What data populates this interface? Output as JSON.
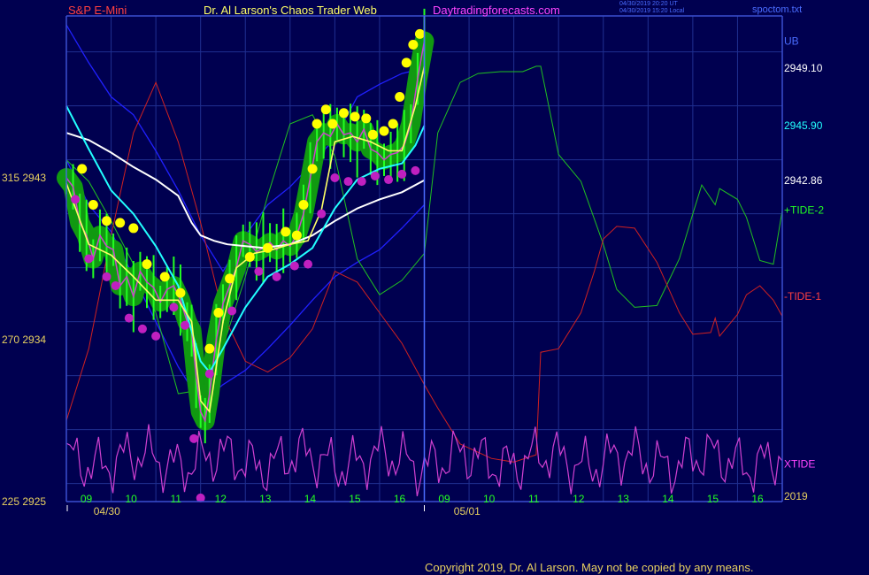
{
  "header": {
    "symbol": "S&P E-Mini",
    "title": "Dr. Al Larson's Chaos Trader Web",
    "site": "Daytradingforecasts.com",
    "timestamp_ut": "04/30/2019 20:20 UT",
    "timestamp_local": "04/30/2019 15:20 Local",
    "file": "spoctom.txt"
  },
  "footer": {
    "copyright": "Copyright 2019, Dr. Al Larson. May not be copied by any means."
  },
  "colors": {
    "background": "#000050",
    "grid": "#1f2f90",
    "axis": "#3a4fd0",
    "price_candles": "#22ff22",
    "price_halo": "#119911",
    "highs": "#ffff00",
    "lows": "#c020c0",
    "fast_ma": "#ffff66",
    "mid_ma": "#22ffff",
    "slow_ma": "#ffffff",
    "band": "#2020ff",
    "tide_plus": "#20c020",
    "tide_minus": "#d02020",
    "xtide": "#d040d0"
  },
  "chart_data": {
    "type": "line",
    "title": "S&P E-Mini",
    "y_range": [
      2925,
      2952
    ],
    "left_axis_labels": [
      {
        "text": "315  2943",
        "value": 2943
      },
      {
        "text": "270  2934",
        "value": 2934
      },
      {
        "text": "225  2925",
        "value": 2925
      }
    ],
    "right_axis_labels": [
      {
        "text": "UB",
        "value": 2950.6,
        "color": "#4a6cff"
      },
      {
        "text": "2949.10",
        "value": 2949.1,
        "color": "#ffffff"
      },
      {
        "text": "2945.90",
        "value": 2945.9,
        "color": "#22ffff"
      },
      {
        "text": "2942.86",
        "value": 2942.86,
        "color": "#ffffff"
      },
      {
        "text": "+TIDE-2",
        "value": 2941.2,
        "color": "#22ff22"
      },
      {
        "text": "-TIDE-1",
        "value": 2936.4,
        "color": "#ff4040"
      },
      {
        "text": "XTIDE",
        "value": 2927.1,
        "color": "#ff44ff"
      },
      {
        "text": "2019",
        "value": 2925.3,
        "color": "#e8d060"
      }
    ],
    "x_range": [
      0,
      16
    ],
    "hour_ticks": [
      {
        "label": "09",
        "x": 1
      },
      {
        "label": "10",
        "x": 2
      },
      {
        "label": "11",
        "x": 3
      },
      {
        "label": "12",
        "x": 4
      },
      {
        "label": "13",
        "x": 5
      },
      {
        "label": "14",
        "x": 6
      },
      {
        "label": "15",
        "x": 7
      },
      {
        "label": "16",
        "x": 8
      },
      {
        "label": "09",
        "x": 9
      },
      {
        "label": "10",
        "x": 10
      },
      {
        "label": "11",
        "x": 11
      },
      {
        "label": "12",
        "x": 12
      },
      {
        "label": "13",
        "x": 13
      },
      {
        "label": "14",
        "x": 14
      },
      {
        "label": "15",
        "x": 15
      },
      {
        "label": "16",
        "x": 16
      }
    ],
    "date_markers": [
      {
        "label": "04/30",
        "x": 0.45
      },
      {
        "label": "05/01",
        "x": 8.5
      }
    ],
    "day_divider_x": 8,
    "series": [
      {
        "key": "price",
        "x": [
          0,
          0.15,
          0.3,
          0.45,
          0.6,
          0.75,
          0.9,
          1.05,
          1.2,
          1.35,
          1.5,
          1.65,
          1.8,
          1.95,
          2.1,
          2.25,
          2.4,
          2.55,
          2.7,
          2.8,
          2.9,
          3,
          3.1,
          3.2,
          3.35,
          3.5,
          3.65,
          3.8,
          3.95,
          4.1,
          4.25,
          4.4,
          4.55,
          4.7,
          4.85,
          5,
          5.15,
          5.3,
          5.45,
          5.6,
          5.75,
          5.9,
          6.05,
          6.2,
          6.35,
          6.5,
          6.65,
          6.8,
          6.95,
          7.1,
          7.25,
          7.4,
          7.55,
          7.7,
          7.85,
          8
        ],
        "y": [
          2943,
          2942.5,
          2940.5,
          2939.8,
          2938.5,
          2939.8,
          2939.2,
          2939,
          2937,
          2937.5,
          2936.4,
          2937.8,
          2937.2,
          2936.9,
          2936.1,
          2936.8,
          2937,
          2936.2,
          2935,
          2934.5,
          2932,
          2930,
          2929.5,
          2931,
          2934,
          2936,
          2937,
          2938,
          2939.5,
          2939.3,
          2938.9,
          2939.1,
          2939.4,
          2939,
          2939.5,
          2939.2,
          2939.8,
          2941,
          2943,
          2945,
          2945.5,
          2945.3,
          2946,
          2945.4,
          2945.5,
          2945,
          2945.7,
          2944.6,
          2944.4,
          2944,
          2944.3,
          2944.4,
          2944.8,
          2946,
          2948.5,
          2950.6
        ]
      },
      {
        "key": "highs",
        "x": [
          0.35,
          0.6,
          0.9,
          1.2,
          1.5,
          1.8,
          2.2,
          2.55,
          3.2,
          3.4,
          3.65,
          4.1,
          4.5,
          4.9,
          5.15,
          5.3,
          5.5,
          5.6,
          5.8,
          5.95,
          6.2,
          6.45,
          6.7,
          6.85,
          7.1,
          7.3,
          7.45,
          7.6,
          7.75,
          7.9
        ],
        "y": [
          2943.5,
          2941.5,
          2940.6,
          2940.5,
          2940.2,
          2938.2,
          2937.5,
          2936.6,
          2933.5,
          2935.5,
          2937.4,
          2938.6,
          2939.1,
          2940,
          2939.8,
          2941.5,
          2943.5,
          2946,
          2946.8,
          2946,
          2946.6,
          2946.4,
          2946.3,
          2945.4,
          2945.6,
          2946,
          2947.5,
          2949.4,
          2950.4,
          2951
        ]
      },
      {
        "key": "lows",
        "x": [
          0.2,
          0.5,
          0.9,
          1.1,
          1.4,
          1.7,
          2,
          2.4,
          2.65,
          2.85,
          3,
          3.2,
          3.7,
          4.3,
          4.7,
          5.1,
          5.4,
          5.7,
          6,
          6.3,
          6.6,
          6.9,
          7.2,
          7.5,
          7.8
        ],
        "y": [
          2941.8,
          2938.5,
          2937.5,
          2937,
          2935.2,
          2934.6,
          2934.2,
          2935.8,
          2934.8,
          2928.5,
          2925.2,
          2932.1,
          2935.6,
          2937.8,
          2937.5,
          2938.1,
          2938.2,
          2941,
          2943,
          2942.8,
          2942.8,
          2943.1,
          2942.9,
          2943.2,
          2943.4
        ]
      },
      {
        "key": "fast_ma",
        "x": [
          0,
          0.5,
          1,
          1.5,
          2,
          2.5,
          2.8,
          3,
          3.2,
          3.5,
          3.8,
          4.2,
          4.6,
          5,
          5.4,
          5.7,
          6,
          6.4,
          6.8,
          7.2,
          7.5,
          7.8,
          8
        ],
        "y": [
          2942.7,
          2939.3,
          2938.7,
          2937.5,
          2936.2,
          2936.2,
          2935,
          2930.6,
          2930,
          2935,
          2938,
          2938.8,
          2939,
          2939.3,
          2939.5,
          2941.2,
          2945,
          2945.3,
          2945,
          2944.5,
          2944.5,
          2947,
          2949.2
        ]
      },
      {
        "key": "mid_ma",
        "x": [
          0,
          0.5,
          1,
          1.5,
          2,
          2.5,
          3,
          3.2,
          3.5,
          4,
          4.5,
          5,
          5.5,
          6,
          6.5,
          7,
          7.5,
          7.8,
          8
        ],
        "y": [
          2947,
          2944.6,
          2942.3,
          2941,
          2939.2,
          2937,
          2932.8,
          2932.2,
          2933.5,
          2935.8,
          2937.5,
          2938.2,
          2939.1,
          2941.3,
          2942.9,
          2943.5,
          2943.8,
          2944.8,
          2945.9
        ]
      },
      {
        "key": "slow_ma",
        "x": [
          0,
          0.5,
          1,
          1.5,
          2,
          2.5,
          2.8,
          3,
          3.3,
          3.6,
          4,
          4.4,
          5,
          5.5,
          6,
          6.5,
          7,
          7.5,
          8
        ],
        "y": [
          2945.5,
          2945.1,
          2944.4,
          2943.6,
          2942.9,
          2942,
          2940.5,
          2939.8,
          2939.5,
          2939.3,
          2939.2,
          2939.1,
          2939.3,
          2939.8,
          2940.6,
          2941.3,
          2941.8,
          2942.2,
          2942.86
        ]
      },
      {
        "key": "upper_band",
        "x": [
          0,
          0.5,
          1,
          1.5,
          2,
          2.5,
          3,
          3.5,
          4,
          4.5,
          5,
          5.5,
          6,
          6.5,
          7,
          7.5,
          8
        ],
        "y": [
          2951.5,
          2949.4,
          2947.5,
          2946.5,
          2944.5,
          2942.3,
          2939.8,
          2937.8,
          2939.8,
          2941.5,
          2942.5,
          2943.8,
          2945.2,
          2947.5,
          2948.2,
          2948.8,
          2949.1
        ]
      },
      {
        "key": "lower_band",
        "x": [
          0,
          0.5,
          1,
          1.5,
          2,
          2.5,
          3,
          3.5,
          4,
          4.5,
          5,
          5.5,
          6,
          6.5,
          7,
          7.5,
          8
        ],
        "y": [
          2944,
          2941.5,
          2940,
          2937.5,
          2935,
          2932.5,
          2930.5,
          2931.5,
          2932.3,
          2933.5,
          2934.8,
          2936.2,
          2937.5,
          2938.3,
          2939,
          2940.2,
          2941.5
        ]
      },
      {
        "key": "tide_plus",
        "name": "+TIDE-2",
        "x": [
          0,
          0.5,
          1,
          1.5,
          2,
          2.5,
          3,
          3.5,
          4,
          4.5,
          5,
          5.5,
          6,
          6.5,
          7,
          7.5,
          8,
          8.3,
          8.8,
          9.2,
          9.7,
          10.2,
          10.5,
          10.6,
          11,
          11.5,
          12,
          12.3,
          12.7,
          13.2,
          13.7,
          14,
          14.2,
          14.5,
          14.6,
          15,
          15.2,
          15.5,
          15.8,
          16
        ],
        "y": [
          2944,
          2942.8,
          2940.6,
          2938.2,
          2935.5,
          2931,
          2931.2,
          2933.6,
          2937.5,
          2942,
          2946,
          2946.5,
          2944.2,
          2938.5,
          2936.5,
          2937.3,
          2938.8,
          2945.5,
          2948.3,
          2948.8,
          2948.9,
          2948.9,
          2949.2,
          2949.2,
          2944.3,
          2942.8,
          2939.3,
          2936.8,
          2935.8,
          2935.9,
          2938.5,
          2941,
          2942.6,
          2941.5,
          2942.4,
          2941.8,
          2940.8,
          2938.4,
          2938.2,
          2941.2
        ]
      },
      {
        "key": "tide_minus",
        "name": "-TIDE-1",
        "x": [
          0,
          0.5,
          1,
          1.5,
          2,
          2.5,
          3,
          3.5,
          4,
          4.5,
          5,
          5.5,
          6,
          6.5,
          7,
          7.5,
          8,
          8.3,
          8.8,
          9.5,
          10,
          10.5,
          10.6,
          11,
          11.5,
          11.8,
          12,
          12.3,
          12.7,
          13.2,
          13.7,
          14,
          14.4,
          14.5,
          14.6,
          15,
          15.2,
          15.5,
          15.8,
          16
        ],
        "y": [
          2929.5,
          2933.5,
          2939.8,
          2945.5,
          2948.3,
          2945,
          2940.5,
          2935.4,
          2932.8,
          2932.2,
          2933,
          2934.6,
          2937.8,
          2937.2,
          2935.5,
          2933.8,
          2931.5,
          2930.2,
          2928.2,
          2927.4,
          2927.2,
          2927.6,
          2933.3,
          2933.5,
          2935.5,
          2937.8,
          2939.6,
          2940.3,
          2940.2,
          2938.3,
          2935.5,
          2934.3,
          2934.4,
          2935.2,
          2934.2,
          2935.4,
          2936.5,
          2937,
          2936.2,
          2935.3
        ]
      }
    ],
    "xtide": {
      "name": "XTIDE",
      "amplitude_range": [
        2925.3,
        2929.3
      ],
      "x_step": 0.08,
      "components": [
        {
          "freq": 1.75,
          "amp": 1.0,
          "phase": 0.0
        },
        {
          "freq": 4.4,
          "amp": 0.75,
          "phase": 1.1
        },
        {
          "freq": 0.55,
          "amp": 0.35,
          "phase": 2.3
        }
      ]
    }
  }
}
